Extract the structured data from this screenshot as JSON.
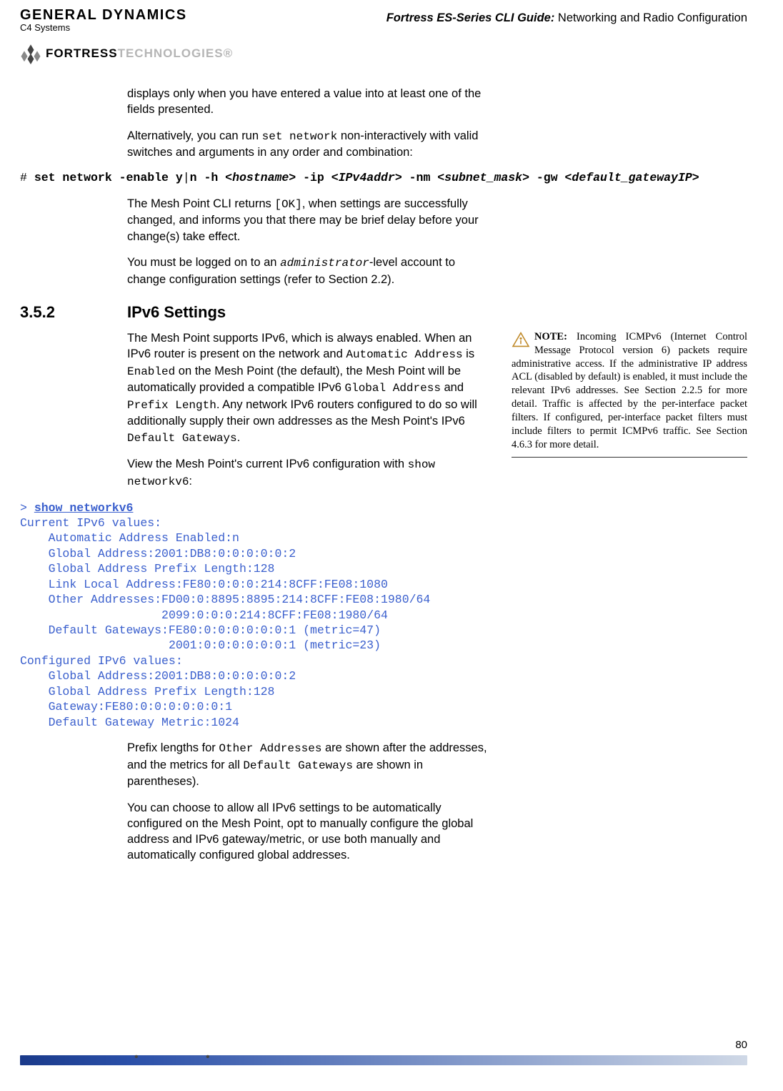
{
  "header": {
    "logo_gd": "GENERAL DYNAMICS",
    "logo_c4": "C4 Systems",
    "guide_bold": "Fortress ES-Series CLI Guide:",
    "guide_rest": " Networking and Radio Configuration",
    "fortress_bold": "FORTRESS",
    "fortress_gray": "TECHNOLOGIES®"
  },
  "para1": "displays only when you have entered a value into at least one of the fields presented.",
  "para2a": "Alternatively, you can run ",
  "para2_code": "set network",
  "para2b": " non-interactively with valid switches and arguments in any order and combination:",
  "cmd1": "# set network -enable y|n -h <hostname> -ip <IPv4addr> -nm <subnet_mask> -gw <default_gatewayIP>",
  "para3a": "The Mesh Point CLI returns ",
  "para3_code": "[OK]",
  "para3b": ", when settings are successfully changed, and informs you that there may be brief delay before your change(s) take effect.",
  "para4a": "You must be logged on to an ",
  "para4_code": "administrator",
  "para4b": "-level account to change configuration settings (refer to Section 2.2).",
  "section": {
    "num": "3.5.2",
    "title": "IPv6 Settings"
  },
  "para5a": "The Mesh Point supports IPv6, which is always enabled. When an IPv6 router is present on the network and ",
  "para5_c1": "Automatic Address",
  "para5b": " is ",
  "para5_c2": "Enabled",
  "para5c": " on the Mesh Point (the default), the Mesh Point will be automatically provided a compatible IPv6 ",
  "para5_c3": "Global Address",
  "para5d": " and ",
  "para5_c4": "Prefix Length",
  "para5e": ". Any network IPv6 routers configured to do so will additionally supply their own addresses as the Mesh Point's IPv6 ",
  "para5_c5": "Default Gateways",
  "para5f": ".",
  "para6a": "View the Mesh Point's current IPv6 configuration with ",
  "para6_code": "show networkv6",
  "para6b": ":",
  "cli_prompt": "> ",
  "cli_cmd": "show networkv6",
  "cli_output": "Current IPv6 values:\n    Automatic Address Enabled:n\n    Global Address:2001:DB8:0:0:0:0:0:2\n    Global Address Prefix Length:128\n    Link Local Address:FE80:0:0:0:214:8CFF:FE08:1080\n    Other Addresses:FD00:0:8895:8895:214:8CFF:FE08:1980/64\n                    2099:0:0:0:214:8CFF:FE08:1980/64\n    Default Gateways:FE80:0:0:0:0:0:0:1 (metric=47)\n                     2001:0:0:0:0:0:0:1 (metric=23)\nConfigured IPv6 values:\n    Global Address:2001:DB8:0:0:0:0:0:2\n    Global Address Prefix Length:128\n    Gateway:FE80:0:0:0:0:0:0:1\n    Default Gateway Metric:1024",
  "para7a": "Prefix lengths for ",
  "para7_c1": "Other Addresses",
  "para7b": " are shown after the addresses, and the metrics for all ",
  "para7_c2": "Default Gateways",
  "para7c": " are shown in parentheses).",
  "para8": "You can choose to allow all IPv6 settings to be automatically configured on the Mesh Point, opt to manually configure the global address and IPv6 gateway/metric, or use both manually and automatically configured global addresses.",
  "note": {
    "label": "NOTE:",
    "text": " Incoming ICMPv6 (Internet Control Message Protocol version 6) packets require administrative access. If the administrative IP address ACL (disabled by default) is enabled, it must include the relevant IPv6 addresses. See Section 2.2.5 for more detail. Traffic is affected by the per-interface packet filters. If configured, per-interface packet filters must include filters to permit ICMPv6 traffic. See Section 4.6.3 for more detail."
  },
  "page_number": "80"
}
